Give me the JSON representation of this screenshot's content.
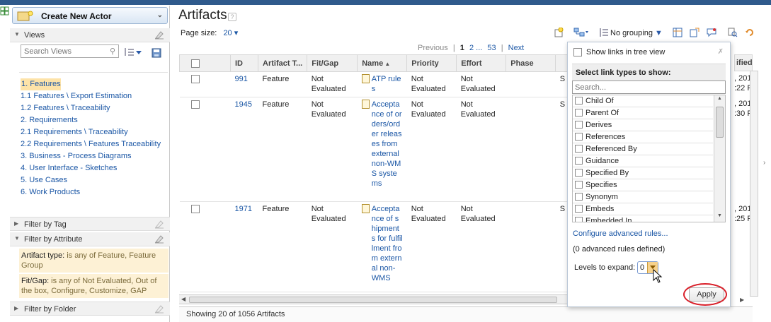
{
  "left": {
    "create_button": "Create New Actor",
    "views_header": "Views",
    "search_placeholder": "Search Views",
    "views": [
      "1. Features",
      "1.1 Features \\ Export Estimation",
      "1.2 Features \\ Traceability",
      "2. Requirements",
      "2.1 Requirements \\ Traceability",
      "2.2 Requirements \\ Features Traceability",
      "3. Business - Process Diagrams",
      "4. User Interface - Sketches",
      "5. Use Cases",
      "6. Work Products"
    ],
    "filter_by_tag": "Filter by Tag",
    "filter_by_attribute": "Filter by Attribute",
    "filter_attr_1_label": "Artifact type:",
    "filter_attr_1_value": " is any of Feature, Feature Group",
    "filter_attr_2_label": "Fit/Gap:",
    "filter_attr_2_value": " is any of Not Evaluated, Out of the box, Configure, Customize, GAP",
    "filter_by_folder": "Filter by Folder"
  },
  "main": {
    "title": "Artifacts",
    "page_size_label": "Page size:",
    "page_size_value": "20",
    "grouping": "No grouping",
    "pager": {
      "previous": "Previous",
      "sep": "|",
      "p1": "1",
      "p2": "2",
      "ellipsis": "...",
      "last": "53",
      "next": "Next"
    },
    "columns": [
      "ID",
      "Artifact T...",
      "Fit/Gap",
      "Name",
      "Priority",
      "Effort",
      "Phase",
      "ified..."
    ],
    "rows": [
      {
        "id": "991",
        "type": "Feature",
        "fitgap": "Not Evaluated",
        "name": "ATP rules",
        "priority": "Not Evaluated",
        "effort": "Not Evaluated",
        "col_s": "S",
        "modified": ", 201\n:22 P"
      },
      {
        "id": "1945",
        "type": "Feature",
        "fitgap": "Not Evaluated",
        "name": "Acceptance of orders/order releases from external non-WMS systems",
        "priority": "Not Evaluated",
        "effort": "Not Evaluated",
        "col_s": "S",
        "modified": ", 201\n:30 P"
      },
      {
        "id": "1971",
        "type": "Feature",
        "fitgap": "Not Evaluated",
        "name": "Acceptance of shipments for fulfillment from external non-WMS",
        "priority": "Not Evaluated",
        "effort": "Not Evaluated",
        "col_s": "S",
        "modified": ", 201\n:25 P"
      }
    ],
    "status": "Showing 20 of 1056 Artifacts"
  },
  "popup": {
    "show_links_label": "Show links in tree view",
    "select_title": "Select link types to show:",
    "search_placeholder": "Search...",
    "link_types": [
      "Child Of",
      "Parent Of",
      "Derives",
      "References",
      "Referenced By",
      "Guidance",
      "Specified By",
      "Specifies",
      "Synonym",
      "Embeds",
      "Embedded In"
    ],
    "configure": "Configure advanced rules...",
    "advanced_count": "(0 advanced rules defined)",
    "levels_label": "Levels to expand:",
    "levels_value": "0",
    "apply": "Apply"
  },
  "colors": {
    "accent": "#1a56a5",
    "selection": "#fde3a8",
    "filter_bg": "#fdf1d5",
    "highlight_ring": "#d9202a"
  }
}
